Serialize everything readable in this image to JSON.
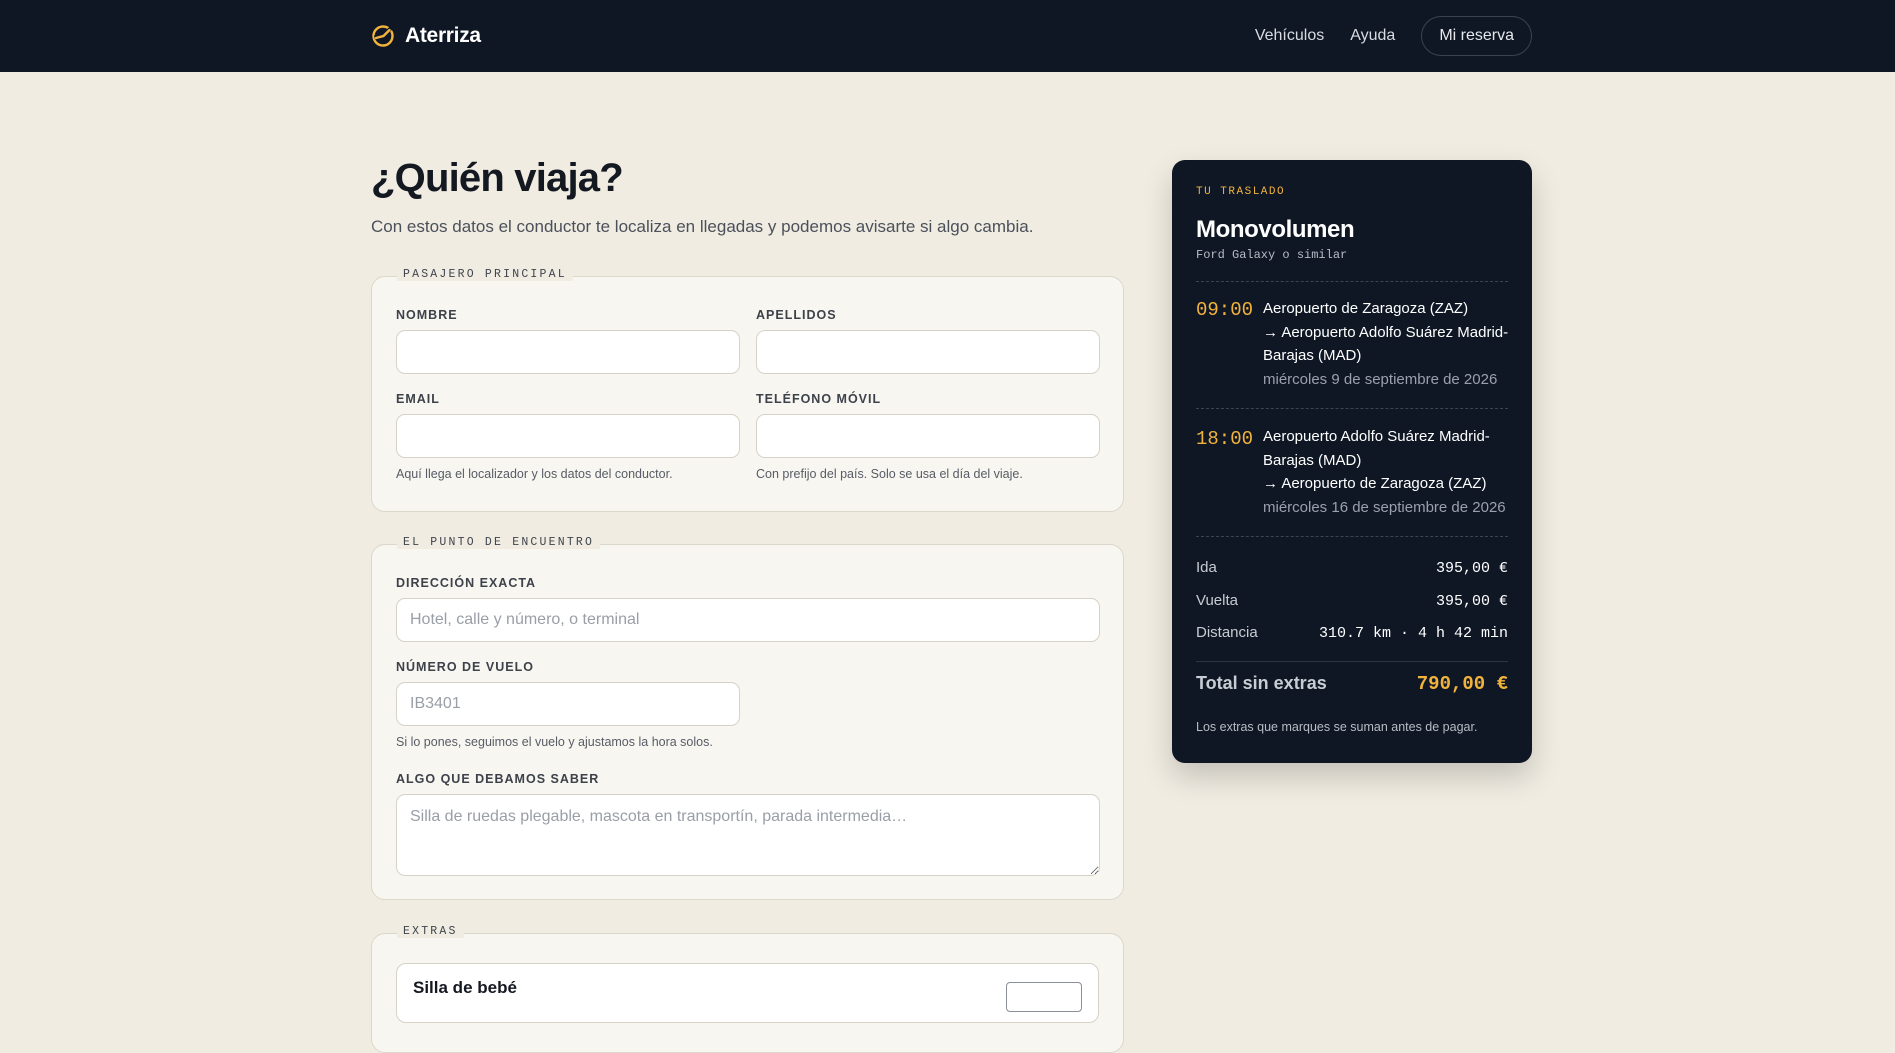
{
  "nav": {
    "brand": "Aterriza",
    "links": [
      "Vehículos",
      "Ayuda"
    ],
    "reservation_button": "Mi reserva"
  },
  "page": {
    "title": "¿Quién viaja?",
    "subtitle": "Con estos datos el conductor te localiza en llegadas y podemos avisarte si algo cambia."
  },
  "passenger": {
    "legend": "PASAJERO PRINCIPAL",
    "name_label": "NOMBRE",
    "name_value": "",
    "surname_label": "APELLIDOS",
    "surname_value": "",
    "email_label": "EMAIL",
    "email_value": "",
    "email_hint": "Aquí llega el localizador y los datos del conductor.",
    "phone_label": "TELÉFONO MÓVIL",
    "phone_value": "",
    "phone_hint": "Con prefijo del país. Solo se usa el día del viaje."
  },
  "meeting": {
    "legend": "EL PUNTO DE ENCUENTRO",
    "address_label": "DIRECCIÓN EXACTA",
    "address_placeholder": "Hotel, calle y número, o terminal",
    "flight_label": "NÚMERO DE VUELO",
    "flight_placeholder": "IB3401",
    "flight_hint": "Si lo pones, seguimos el vuelo y ajustamos la hora solos.",
    "notes_label": "ALGO QUE DEBAMOS SABER",
    "notes_placeholder": "Silla de ruedas plegable, mascota en transportín, parada intermedia…"
  },
  "extras": {
    "legend": "EXTRAS",
    "items": [
      {
        "name": "Silla de bebé"
      }
    ]
  },
  "summary": {
    "eyebrow": "TU TRASLADO",
    "vehicle": "Monovolumen",
    "vehicle_similar": "Ford Galaxy o similar",
    "trips": [
      {
        "time": "09:00",
        "from": "Aeropuerto de Zaragoza (ZAZ)",
        "to": "→ Aeropuerto Adolfo Suárez Madrid-Barajas (MAD)",
        "date": "miércoles 9 de septiembre de 2026"
      },
      {
        "time": "18:00",
        "from": "Aeropuerto Adolfo Suárez Madrid-Barajas (MAD)",
        "to": "→ Aeropuerto de Zaragoza (ZAZ)",
        "date": "miércoles 16 de septiembre de 2026"
      }
    ],
    "prices": [
      {
        "label": "Ida",
        "value": "395,00 €"
      },
      {
        "label": "Vuelta",
        "value": "395,00 €"
      },
      {
        "label": "Distancia",
        "value": "310.7 km · 4 h 42 min"
      }
    ],
    "total_label": "Total sin extras",
    "total_value": "790,00 €",
    "note": "Los extras que marques se suman antes de pagar."
  },
  "colors": {
    "nav_bg": "#0f1724",
    "page_bg": "#f0ece2",
    "accent": "#f2b33d",
    "summary_bg": "#0f1724"
  },
  "icons": {
    "brand": "plane-landing-icon"
  }
}
